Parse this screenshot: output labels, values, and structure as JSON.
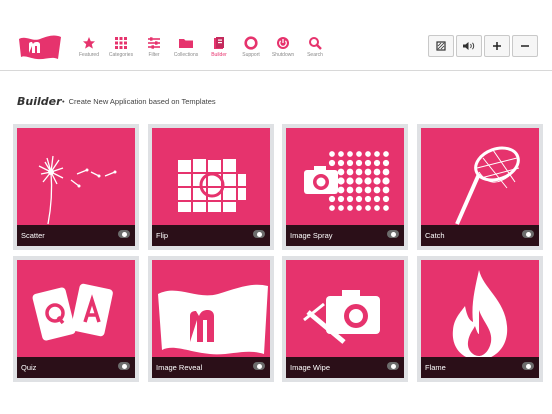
{
  "nav": {
    "items": [
      {
        "label": "Featured",
        "icon": "star-icon"
      },
      {
        "label": "Categories",
        "icon": "grid-icon"
      },
      {
        "label": "Filter",
        "icon": "sliders-icon"
      },
      {
        "label": "Collections",
        "icon": "folder-icon"
      },
      {
        "label": "Builder",
        "icon": "builder-icon",
        "active": true
      },
      {
        "label": "Support",
        "icon": "lifebuoy-icon"
      },
      {
        "label": "Shutdown",
        "icon": "power-icon"
      },
      {
        "label": "Search",
        "icon": "search-icon"
      }
    ]
  },
  "controls": {
    "buttons": [
      {
        "icon": "screen-icon"
      },
      {
        "icon": "volume-icon"
      },
      {
        "label": "+",
        "icon": "plus-icon"
      },
      {
        "label": "−",
        "icon": "minus-icon"
      }
    ]
  },
  "header": {
    "title": "Builder",
    "bullet": "•",
    "subtitle": "Create New Application based on Templates"
  },
  "tiles": [
    {
      "label": "Scatter",
      "icon": "dandelion-icon"
    },
    {
      "label": "Flip",
      "icon": "flip-camera-icon"
    },
    {
      "label": "Image Spray",
      "icon": "spray-camera-icon"
    },
    {
      "label": "Catch",
      "icon": "butterfly-net-icon"
    },
    {
      "label": "Quiz",
      "icon": "quiz-cards-icon"
    },
    {
      "label": "Image Reveal",
      "icon": "logo-flag-icon"
    },
    {
      "label": "Image Wipe",
      "icon": "wiper-camera-icon"
    },
    {
      "label": "Flame",
      "icon": "flame-icon"
    }
  ],
  "colors": {
    "accent": "#e6336d",
    "tile_bar": "#2b0f18",
    "tile_frame": "#dfe1e4"
  }
}
